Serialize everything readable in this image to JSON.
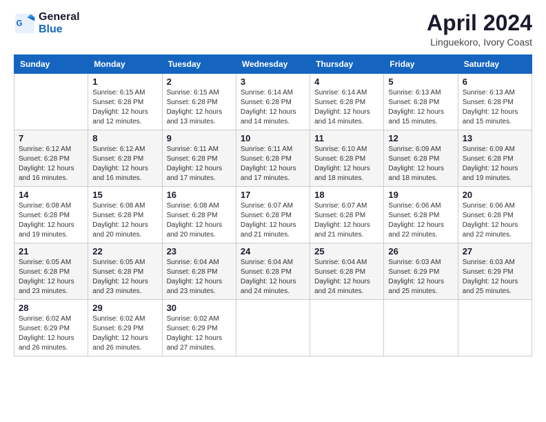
{
  "header": {
    "logo_line1": "General",
    "logo_line2": "Blue",
    "month": "April 2024",
    "location": "Linguekoro, Ivory Coast"
  },
  "weekdays": [
    "Sunday",
    "Monday",
    "Tuesday",
    "Wednesday",
    "Thursday",
    "Friday",
    "Saturday"
  ],
  "weeks": [
    [
      {
        "num": "",
        "info": ""
      },
      {
        "num": "1",
        "info": "Sunrise: 6:15 AM\nSunset: 6:28 PM\nDaylight: 12 hours\nand 12 minutes."
      },
      {
        "num": "2",
        "info": "Sunrise: 6:15 AM\nSunset: 6:28 PM\nDaylight: 12 hours\nand 13 minutes."
      },
      {
        "num": "3",
        "info": "Sunrise: 6:14 AM\nSunset: 6:28 PM\nDaylight: 12 hours\nand 14 minutes."
      },
      {
        "num": "4",
        "info": "Sunrise: 6:14 AM\nSunset: 6:28 PM\nDaylight: 12 hours\nand 14 minutes."
      },
      {
        "num": "5",
        "info": "Sunrise: 6:13 AM\nSunset: 6:28 PM\nDaylight: 12 hours\nand 15 minutes."
      },
      {
        "num": "6",
        "info": "Sunrise: 6:13 AM\nSunset: 6:28 PM\nDaylight: 12 hours\nand 15 minutes."
      }
    ],
    [
      {
        "num": "7",
        "info": "Sunrise: 6:12 AM\nSunset: 6:28 PM\nDaylight: 12 hours\nand 16 minutes."
      },
      {
        "num": "8",
        "info": "Sunrise: 6:12 AM\nSunset: 6:28 PM\nDaylight: 12 hours\nand 16 minutes."
      },
      {
        "num": "9",
        "info": "Sunrise: 6:11 AM\nSunset: 6:28 PM\nDaylight: 12 hours\nand 17 minutes."
      },
      {
        "num": "10",
        "info": "Sunrise: 6:11 AM\nSunset: 6:28 PM\nDaylight: 12 hours\nand 17 minutes."
      },
      {
        "num": "11",
        "info": "Sunrise: 6:10 AM\nSunset: 6:28 PM\nDaylight: 12 hours\nand 18 minutes."
      },
      {
        "num": "12",
        "info": "Sunrise: 6:09 AM\nSunset: 6:28 PM\nDaylight: 12 hours\nand 18 minutes."
      },
      {
        "num": "13",
        "info": "Sunrise: 6:09 AM\nSunset: 6:28 PM\nDaylight: 12 hours\nand 19 minutes."
      }
    ],
    [
      {
        "num": "14",
        "info": "Sunrise: 6:08 AM\nSunset: 6:28 PM\nDaylight: 12 hours\nand 19 minutes."
      },
      {
        "num": "15",
        "info": "Sunrise: 6:08 AM\nSunset: 6:28 PM\nDaylight: 12 hours\nand 20 minutes."
      },
      {
        "num": "16",
        "info": "Sunrise: 6:08 AM\nSunset: 6:28 PM\nDaylight: 12 hours\nand 20 minutes."
      },
      {
        "num": "17",
        "info": "Sunrise: 6:07 AM\nSunset: 6:28 PM\nDaylight: 12 hours\nand 21 minutes."
      },
      {
        "num": "18",
        "info": "Sunrise: 6:07 AM\nSunset: 6:28 PM\nDaylight: 12 hours\nand 21 minutes."
      },
      {
        "num": "19",
        "info": "Sunrise: 6:06 AM\nSunset: 6:28 PM\nDaylight: 12 hours\nand 22 minutes."
      },
      {
        "num": "20",
        "info": "Sunrise: 6:06 AM\nSunset: 6:28 PM\nDaylight: 12 hours\nand 22 minutes."
      }
    ],
    [
      {
        "num": "21",
        "info": "Sunrise: 6:05 AM\nSunset: 6:28 PM\nDaylight: 12 hours\nand 23 minutes."
      },
      {
        "num": "22",
        "info": "Sunrise: 6:05 AM\nSunset: 6:28 PM\nDaylight: 12 hours\nand 23 minutes."
      },
      {
        "num": "23",
        "info": "Sunrise: 6:04 AM\nSunset: 6:28 PM\nDaylight: 12 hours\nand 23 minutes."
      },
      {
        "num": "24",
        "info": "Sunrise: 6:04 AM\nSunset: 6:28 PM\nDaylight: 12 hours\nand 24 minutes."
      },
      {
        "num": "25",
        "info": "Sunrise: 6:04 AM\nSunset: 6:28 PM\nDaylight: 12 hours\nand 24 minutes."
      },
      {
        "num": "26",
        "info": "Sunrise: 6:03 AM\nSunset: 6:29 PM\nDaylight: 12 hours\nand 25 minutes."
      },
      {
        "num": "27",
        "info": "Sunrise: 6:03 AM\nSunset: 6:29 PM\nDaylight: 12 hours\nand 25 minutes."
      }
    ],
    [
      {
        "num": "28",
        "info": "Sunrise: 6:02 AM\nSunset: 6:29 PM\nDaylight: 12 hours\nand 26 minutes."
      },
      {
        "num": "29",
        "info": "Sunrise: 6:02 AM\nSunset: 6:29 PM\nDaylight: 12 hours\nand 26 minutes."
      },
      {
        "num": "30",
        "info": "Sunrise: 6:02 AM\nSunset: 6:29 PM\nDaylight: 12 hours\nand 27 minutes."
      },
      {
        "num": "",
        "info": ""
      },
      {
        "num": "",
        "info": ""
      },
      {
        "num": "",
        "info": ""
      },
      {
        "num": "",
        "info": ""
      }
    ]
  ]
}
